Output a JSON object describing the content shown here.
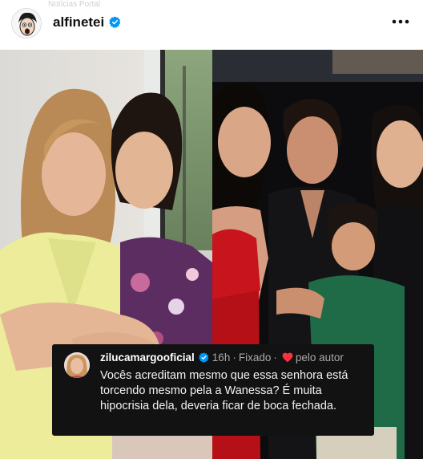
{
  "header": {
    "username": "alfinetei",
    "faint_watermark": "Notícias Portal",
    "more_icon": "more-horizontal-icon",
    "verified_icon": "verified-badge-icon"
  },
  "comment": {
    "username": "zilucamargooficial",
    "time": "16h",
    "pinned": "Fixado",
    "liked_by_author": "pelo autor",
    "text": "Vocês acreditam mesmo que essa senhora está torcendo mesmo pela a Wanessa? É muita hipocrisia dela, deveria ficar de boca fechada.",
    "heart_color": "#ff3040",
    "verified_color": "#0095f6"
  },
  "colors": {
    "background": "#ffffff",
    "comment_bg": "#121212",
    "verified": "#0095f6"
  }
}
